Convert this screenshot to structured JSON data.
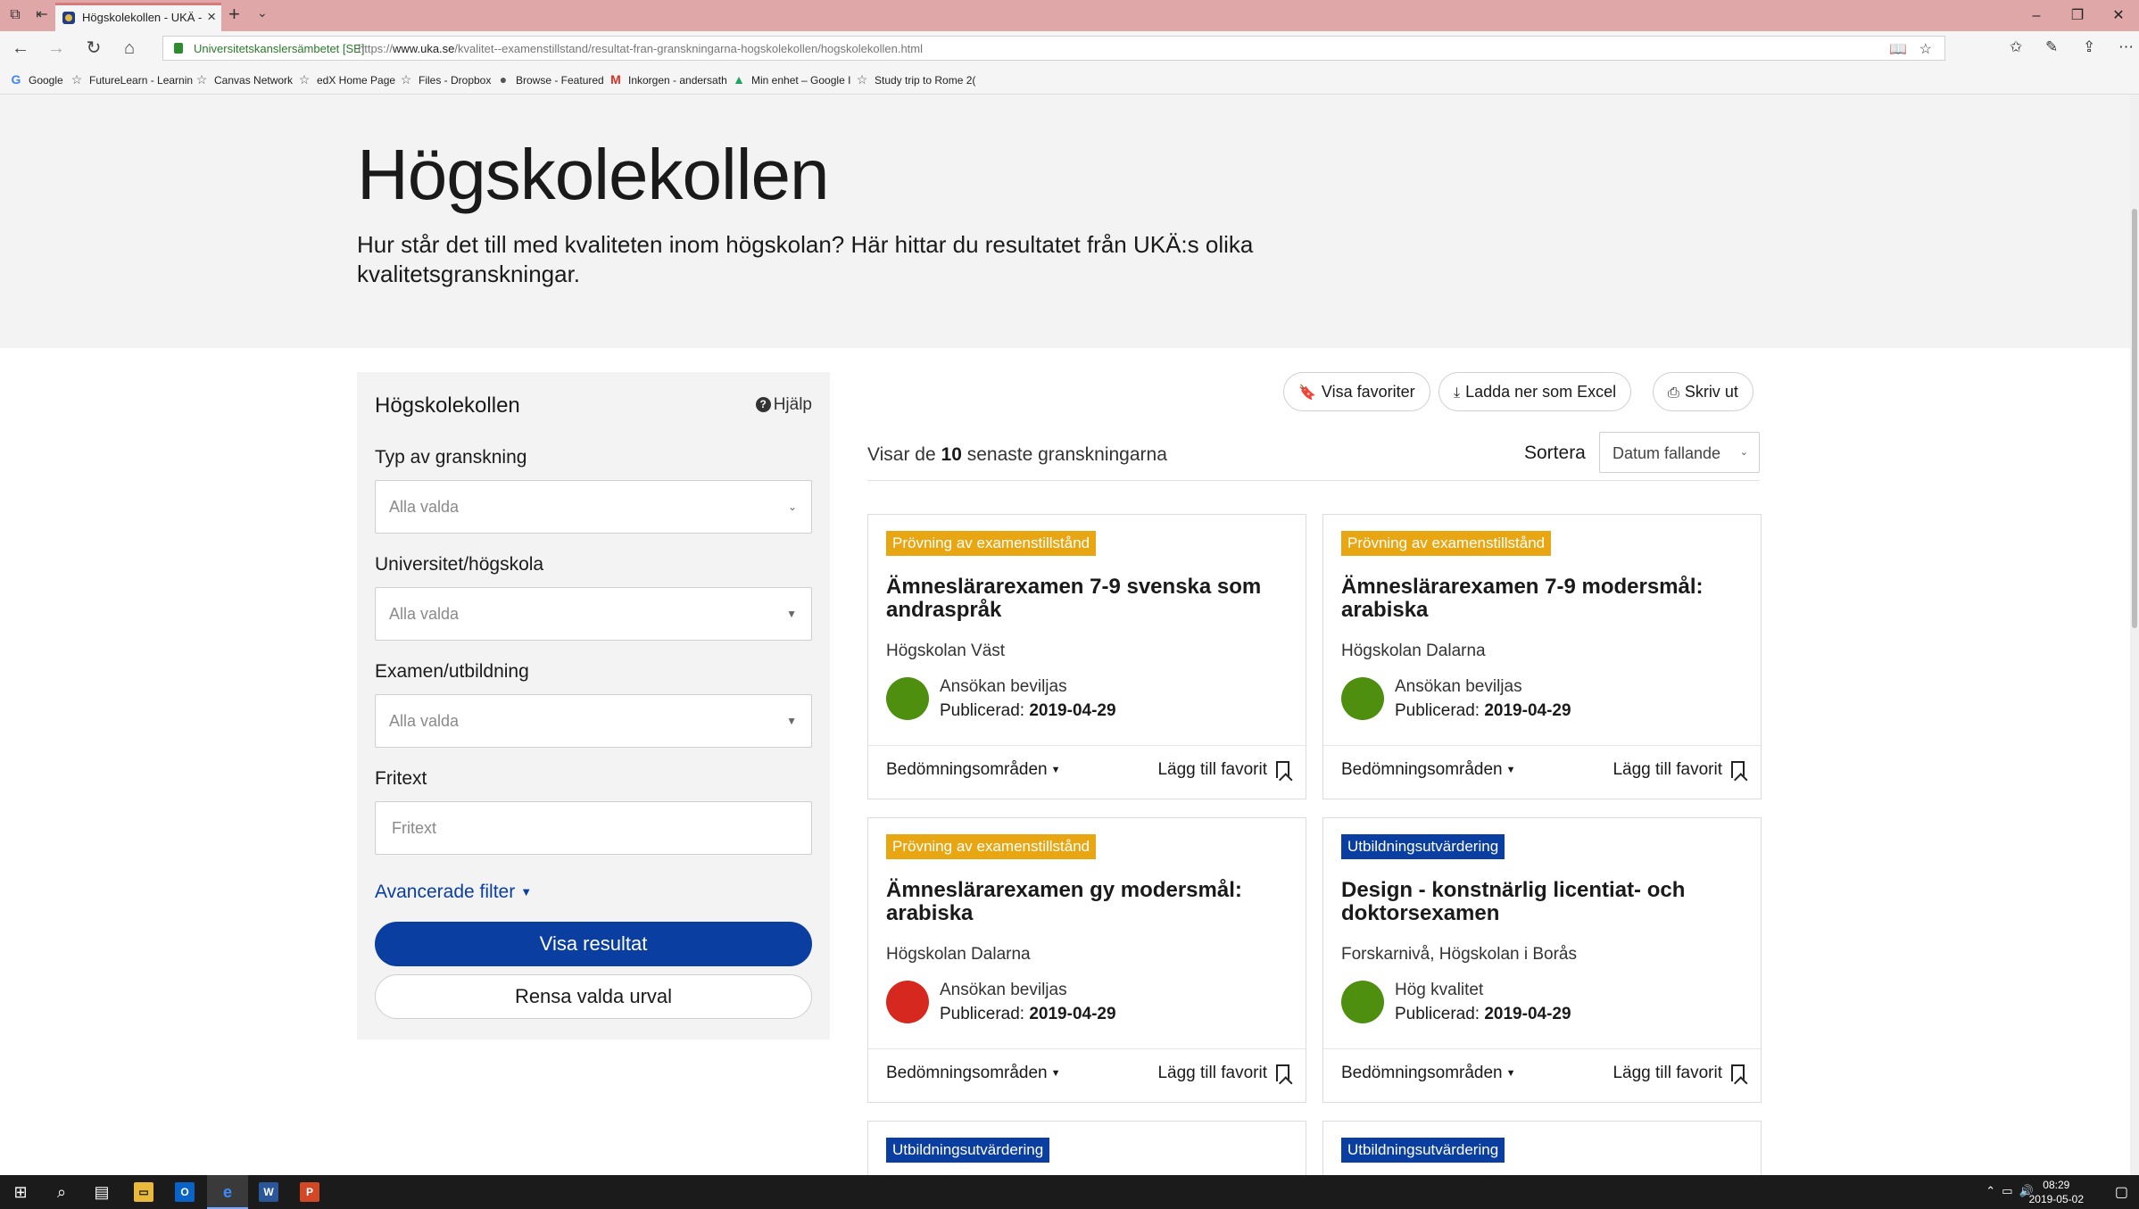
{
  "browser": {
    "tab_title": "Högskolekollen - UKÄ -",
    "cert_label": "Universitetskanslersämbetet [SE]",
    "url_prefix": "https://",
    "url_host": "www.uka.se",
    "url_path": "/kvalitet--examenstillstand/resultat-fran-granskningarna-hogskolekollen/hogskolekollen.html",
    "favorites": [
      {
        "icon": "G",
        "label": "Google"
      },
      {
        "icon": "☆",
        "label": "FutureLearn - Learnin"
      },
      {
        "icon": "☆",
        "label": "Canvas Network"
      },
      {
        "icon": "☆",
        "label": "edX Home Page"
      },
      {
        "icon": "☆",
        "label": "Files - Dropbox"
      },
      {
        "icon": "●",
        "label": "Browse - Featured"
      },
      {
        "icon": "M",
        "label": "Inkorgen - andersath"
      },
      {
        "icon": "▲",
        "label": "Min enhet – Google I"
      },
      {
        "icon": "☆",
        "label": "Study trip to Rome 2("
      }
    ]
  },
  "hero": {
    "title": "Högskolekollen",
    "subtitle": "Hur står det till med kvaliteten inom högskolan? Här hittar du resultatet från UKÄ:s olika kvalitetsgranskningar."
  },
  "sidebar": {
    "title": "Högskolekollen",
    "help_label": "Hjälp",
    "filters": [
      {
        "label": "Typ av granskning",
        "placeholder": "Alla valda"
      },
      {
        "label": "Universitet/högskola",
        "placeholder": "Alla valda"
      },
      {
        "label": "Examen/utbildning",
        "placeholder": "Alla valda"
      }
    ],
    "freetext_label": "Fritext",
    "freetext_placeholder": "Fritext",
    "advanced_label": "Avancerade filter",
    "show_button": "Visa resultat",
    "clear_button": "Rensa valda urval"
  },
  "toolbar": {
    "favorites_label": "Visa favoriter",
    "excel_label": "Ladda ner som Excel",
    "print_label": "Skriv ut"
  },
  "results": {
    "count_prefix": "Visar de",
    "count": "10",
    "count_suffix": "senaste granskningarna",
    "sort_label": "Sortera",
    "sort_value": "Datum fallande"
  },
  "cards": [
    {
      "badge": "Prövning av examenstillstånd",
      "badge_color": "#e8a712",
      "title": "Ämneslärarexamen 7-9 svenska som andraspråk",
      "institution": "Högskolan Väst",
      "status": "Ansökan beviljas",
      "status_color": "#4e8f10",
      "published_label": "Publicerad:",
      "published_date": "2019-04-29",
      "areas_label": "Bedömningsområden",
      "favorite_label": "Lägg till favorit"
    },
    {
      "badge": "Prövning av examenstillstånd",
      "badge_color": "#e8a712",
      "title": "Ämneslärarexamen 7-9 modersmål: arabiska",
      "institution": "Högskolan Dalarna",
      "status": "Ansökan beviljas",
      "status_color": "#4e8f10",
      "published_label": "Publicerad:",
      "published_date": "2019-04-29",
      "areas_label": "Bedömningsområden",
      "favorite_label": "Lägg till favorit"
    },
    {
      "badge": "Prövning av examenstillstånd",
      "badge_color": "#e8a712",
      "title": "Ämneslärarexamen gy modersmål: arabiska",
      "institution": "Högskolan Dalarna",
      "status": "Ansökan beviljas",
      "status_color": "#d6281f",
      "published_label": "Publicerad:",
      "published_date": "2019-04-29",
      "areas_label": "Bedömningsområden",
      "favorite_label": "Lägg till favorit"
    },
    {
      "badge": "Utbildningsutvärdering",
      "badge_color": "#0a3ea0",
      "title": "Design - konstnärlig licentiat- och doktorsexamen",
      "institution": "Forskarnivå, Högskolan i Borås",
      "status": "Hög kvalitet",
      "status_color": "#4e8f10",
      "published_label": "Publicerad:",
      "published_date": "2019-04-29",
      "areas_label": "Bedömningsområden",
      "favorite_label": "Lägg till favorit"
    },
    {
      "badge": "Utbildningsutvärdering",
      "badge_color": "#0a3ea0"
    },
    {
      "badge": "Utbildningsutvärdering",
      "badge_color": "#0a3ea0"
    }
  ],
  "taskbar": {
    "time": "08:29",
    "date": "2019-05-02"
  }
}
